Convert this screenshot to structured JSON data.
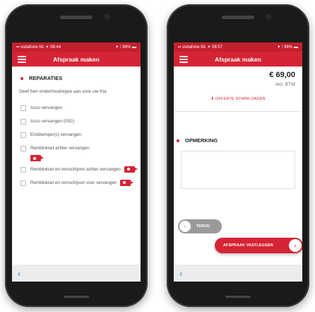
{
  "colors": {
    "brand_red": "#d52434",
    "status_red": "#c41f2e",
    "link_blue": "#4a8be0"
  },
  "left_phone": {
    "status": {
      "left": "▪▪ vodafone NL ✦ 08:44",
      "right": "✦ ⁞ 96% ▬"
    },
    "app_title": "Afspraak maken",
    "section_title": "REPARATIES",
    "intro": "Geef hier onderhoudstype aan voor uw Kia",
    "options": [
      {
        "label": "Accu vervangen"
      },
      {
        "label": "Accu vervangen (ISG)"
      },
      {
        "label": "Eindkemper(s) vervangen"
      },
      {
        "label": "Remblokset achter vervangen"
      },
      {
        "label": "Remblokset en remschijven achter vervangen"
      },
      {
        "label": "Remblokset en remschijven voor vervangen"
      }
    ],
    "back_icon": "chevron-left-icon"
  },
  "right_phone": {
    "status": {
      "left": "▪▪ vodafone NL ✦ 08:57",
      "right": "✦ ⁞ 96% ▬"
    },
    "app_title": "Afspraak maken",
    "price": "€ 69,00",
    "vat": "incl. BTW",
    "offerte_link": "OFFERTE DOWNLOADEN",
    "remark_title": "OPMERKING",
    "toggle_label": "TERUG",
    "cta_label": "AFSPRAAK VASTLEGGEN",
    "back_icon": "chevron-left-icon"
  }
}
